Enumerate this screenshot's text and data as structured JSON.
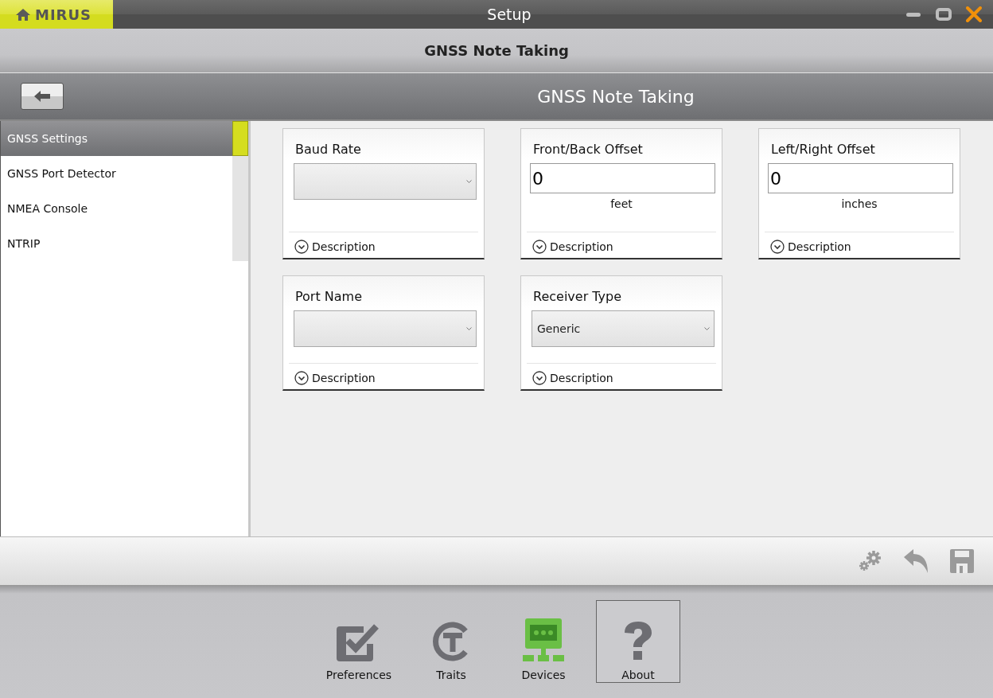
{
  "window": {
    "title": "Setup",
    "brand": "MIRUS"
  },
  "header": {
    "title": "GNSS Note Taking"
  },
  "subheader": {
    "title": "GNSS Note Taking"
  },
  "sidebar": {
    "items": [
      {
        "label": "GNSS Settings",
        "selected": true
      },
      {
        "label": "GNSS Port Detector",
        "selected": false
      },
      {
        "label": "NMEA Console",
        "selected": false
      },
      {
        "label": "NTRIP",
        "selected": false
      }
    ]
  },
  "settings": [
    {
      "kind": "dropdown",
      "label": "Baud Rate",
      "description": "Description"
    },
    {
      "kind": "number",
      "label": "Front/Back Offset",
      "value": "0",
      "unit": "feet",
      "description": "Description"
    },
    {
      "kind": "number",
      "label": "Left/Right Offset",
      "value": "0",
      "unit": "inches",
      "description": "Description"
    },
    {
      "kind": "dropdown",
      "label": "Port Name",
      "description": "Description"
    },
    {
      "kind": "dropdown",
      "label": "Receiver Type",
      "value": "Generic",
      "description": "Description"
    }
  ],
  "nav": [
    {
      "kind": "preferences",
      "label": "Preferences",
      "selected": false,
      "focused": false
    },
    {
      "kind": "traits",
      "label": "Traits",
      "selected": false,
      "focused": false
    },
    {
      "kind": "devices",
      "label": "Devices",
      "selected": true,
      "focused": false
    },
    {
      "kind": "about",
      "label": "About",
      "selected": false,
      "focused": true
    }
  ]
}
